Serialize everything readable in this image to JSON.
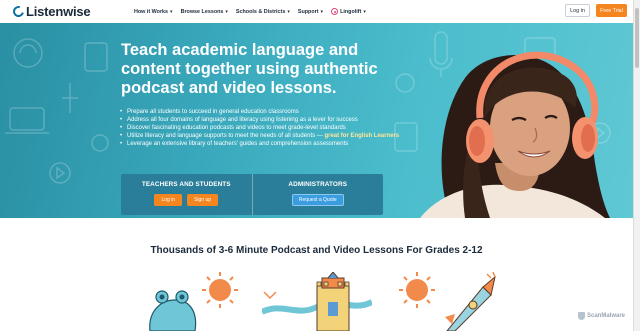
{
  "nav": {
    "logo_text": "Listenwise",
    "menu": [
      {
        "label": "How it Works"
      },
      {
        "label": "Browse Lessons"
      },
      {
        "label": "Schools & Districts"
      },
      {
        "label": "Support"
      },
      {
        "label": "Lingolift"
      }
    ],
    "login_label": "Log in",
    "trial_label": "Free Trial"
  },
  "hero": {
    "title": "Teach academic language and content together using authentic podcast and video lessons.",
    "bullets": [
      "Prepare all students to succeed in general education classrooms",
      "Address all four domains of language and literacy using listening as a lever for success",
      "Discover fascinating education podcasts and videos to meet grade-level standards"
    ],
    "bullet_el_pre": "Utilize literacy and language supports to meet the needs of all students — ",
    "bullet_el_highlight": "great for English Learners",
    "bullet_last": "Leverage an extensive library of teachers' guides and comprehension assessments",
    "teachers_heading": "TEACHERS AND STUDENTS",
    "teachers_login": "Log in",
    "teachers_signup": "Sign up",
    "admins_heading": "ADMINISTRATORS",
    "admins_quote": "Request a Quote"
  },
  "section": {
    "title": "Thousands of 3-6 Minute Podcast and Video Lessons For Grades 2-12"
  },
  "watermark": "ScanMalware",
  "colors": {
    "accent": "#f5851f",
    "hero_teal": "#3aa9bd",
    "cta_box": "#2a7e9a",
    "highlight": "#ffe69a"
  }
}
